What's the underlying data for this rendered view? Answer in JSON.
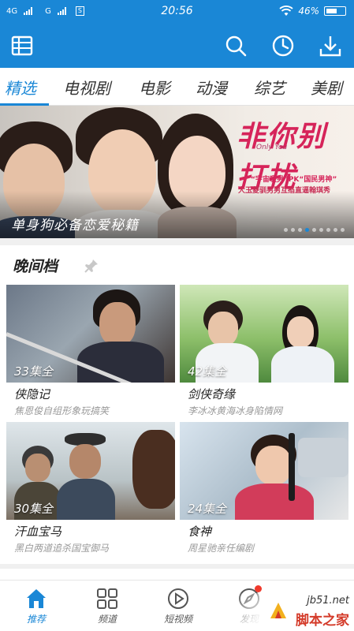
{
  "status_bar": {
    "carrier1": "4G",
    "carrier2": "G",
    "sim_badge": "S",
    "time": "20:56",
    "battery": "46%"
  },
  "app_bar": {
    "icons": [
      "menu-grid-icon",
      "search-icon",
      "history-icon",
      "download-icon"
    ]
  },
  "tabs": [
    {
      "label": "精选",
      "active": true
    },
    {
      "label": "电视剧",
      "active": false
    },
    {
      "label": "电影",
      "active": false
    },
    {
      "label": "动漫",
      "active": false
    },
    {
      "label": "综艺",
      "active": false
    },
    {
      "label": "美剧",
      "active": false
    }
  ],
  "banner": {
    "art_title": "你别打扰",
    "art_title_lead": "非",
    "art_sub": "Only You",
    "art_line1": "“宇宙暖男”PK“国民男神”",
    "art_line2": "大玉菱驯男男互掐直逼翰琪秀",
    "caption": "单身狗必备恋爱秘籍",
    "slide_count": 9,
    "active_slide": 3
  },
  "section": {
    "title": "晚间档",
    "items": [
      {
        "name": "侠隐记",
        "desc": "焦恩俊自组形象玩搞笑",
        "count": "33集全"
      },
      {
        "name": "剑侠奇缘",
        "desc": "李冰冰黄海冰身陷情网",
        "count": "42集全"
      },
      {
        "name": "汗血宝马",
        "desc": "黑白两道追杀国宝御马",
        "count": "30集全"
      },
      {
        "name": "食神",
        "desc": "周星驰亲任编剧",
        "count": "24集全"
      }
    ]
  },
  "bottom_nav": [
    {
      "label": "推荐",
      "icon": "home-icon",
      "active": true
    },
    {
      "label": "频道",
      "icon": "channels-grid-icon",
      "active": false
    },
    {
      "label": "短视频",
      "icon": "play-circle-icon",
      "active": false
    },
    {
      "label": "发现",
      "icon": "compass-icon",
      "active": false
    }
  ],
  "watermark": {
    "line1": "jb51.net",
    "line2": "脚本之家"
  },
  "colors": {
    "primary": "#1a87d6",
    "badge": "#f03a2c"
  }
}
